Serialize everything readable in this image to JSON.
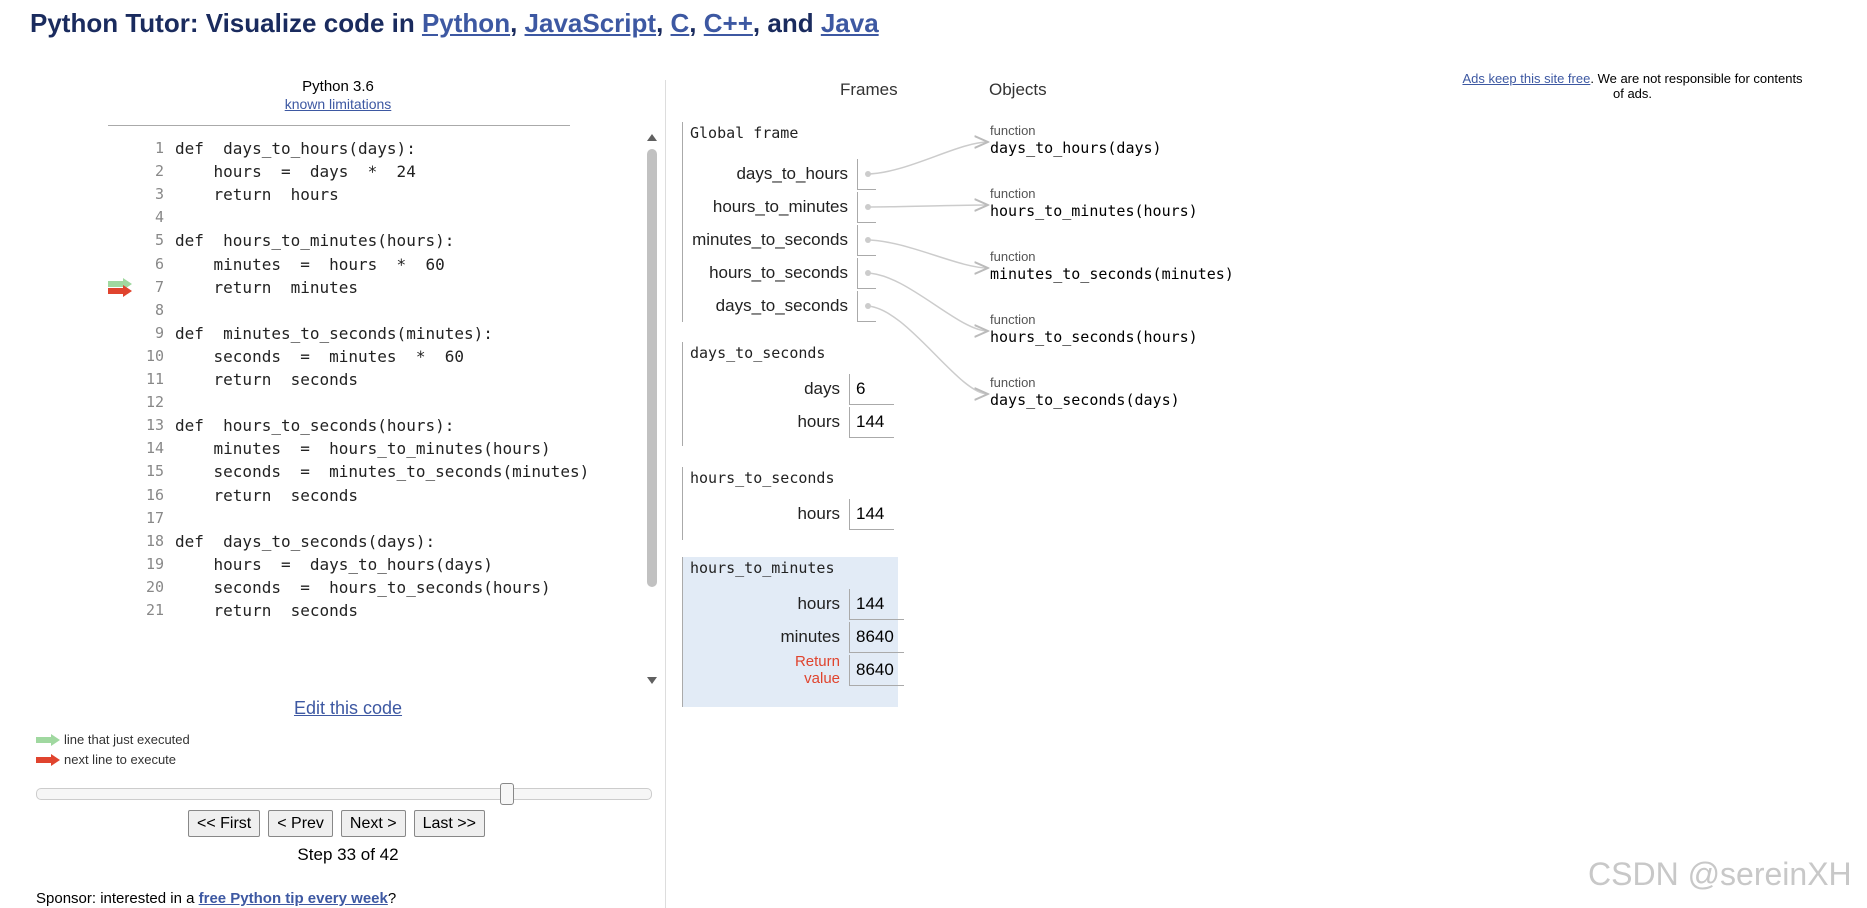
{
  "header": {
    "prefix": "Python Tutor: Visualize code in ",
    "langs": [
      "Python",
      "JavaScript",
      "C",
      "C++",
      "Java"
    ],
    "sep1": ", ",
    "sep2": ", ",
    "sep3": ", ",
    "sep4": ", and "
  },
  "editor": {
    "language": "Python 3.6",
    "limits_link": "known limitations",
    "edit_link": "Edit this code",
    "lines": [
      {
        "n": "1",
        "text": "def  days_to_hours(days):"
      },
      {
        "n": "2",
        "text": "    hours  =  days  *  24"
      },
      {
        "n": "3",
        "text": "    return  hours"
      },
      {
        "n": "4",
        "text": ""
      },
      {
        "n": "5",
        "text": "def  hours_to_minutes(hours):"
      },
      {
        "n": "6",
        "text": "    minutes  =  hours  *  60"
      },
      {
        "n": "7",
        "text": "    return  minutes"
      },
      {
        "n": "8",
        "text": ""
      },
      {
        "n": "9",
        "text": "def  minutes_to_seconds(minutes):"
      },
      {
        "n": "10",
        "text": "    seconds  =  minutes  *  60"
      },
      {
        "n": "11",
        "text": "    return  seconds"
      },
      {
        "n": "12",
        "text": ""
      },
      {
        "n": "13",
        "text": "def  hours_to_seconds(hours):"
      },
      {
        "n": "14",
        "text": "    minutes  =  hours_to_minutes(hours)"
      },
      {
        "n": "15",
        "text": "    seconds  =  minutes_to_seconds(minutes)"
      },
      {
        "n": "16",
        "text": "    return  seconds"
      },
      {
        "n": "17",
        "text": ""
      },
      {
        "n": "18",
        "text": "def  days_to_seconds(days):"
      },
      {
        "n": "19",
        "text": "    hours  =  days_to_hours(days)"
      },
      {
        "n": "20",
        "text": "    seconds  =  hours_to_seconds(hours)"
      },
      {
        "n": "21",
        "text": "    return  seconds"
      }
    ],
    "just_executed_line": "7",
    "next_line": "7"
  },
  "legend": {
    "just_executed": "line that just executed",
    "next_to_execute": "next line to execute",
    "green": "#a0d8a0",
    "red": "#e0442e"
  },
  "nav": {
    "first": "<< First",
    "prev": "< Prev",
    "next": "Next >",
    "last": "Last >>",
    "step_text": "Step 33 of 42",
    "progress": 0.764
  },
  "sponsor": {
    "prefix": "Sponsor: interested in a ",
    "link": "free Python tip every week",
    "suffix": "?"
  },
  "viz": {
    "frames_header": "Frames",
    "objects_header": "Objects",
    "frames": [
      {
        "name": "Global frame",
        "active": false,
        "vars": [
          {
            "name": "days_to_hours",
            "pointer": true
          },
          {
            "name": "hours_to_minutes",
            "pointer": true
          },
          {
            "name": "minutes_to_seconds",
            "pointer": true
          },
          {
            "name": "hours_to_seconds",
            "pointer": true
          },
          {
            "name": "days_to_seconds",
            "pointer": true
          }
        ]
      },
      {
        "name": "days_to_seconds",
        "active": false,
        "vars": [
          {
            "name": "days",
            "value": "6"
          },
          {
            "name": "hours",
            "value": "144"
          }
        ]
      },
      {
        "name": "hours_to_seconds",
        "active": false,
        "vars": [
          {
            "name": "hours",
            "value": "144"
          }
        ]
      },
      {
        "name": "hours_to_minutes",
        "active": true,
        "vars": [
          {
            "name": "hours",
            "value": "144"
          },
          {
            "name": "minutes",
            "value": "8640"
          },
          {
            "name": "Return\nvalue",
            "value": "8640",
            "ret": true
          }
        ]
      }
    ],
    "objects": [
      {
        "type": "function",
        "value": "days_to_hours(days)"
      },
      {
        "type": "function",
        "value": "hours_to_minutes(hours)"
      },
      {
        "type": "function",
        "value": "minutes_to_seconds(minutes)"
      },
      {
        "type": "function",
        "value": "hours_to_seconds(hours)"
      },
      {
        "type": "function",
        "value": "days_to_seconds(days)"
      }
    ],
    "active_frame_color": "#e2ebf6",
    "return_color": "#e0442e"
  },
  "ad": {
    "link": "Ads keep this site free",
    "text": ". We are not responsible for contents of ads."
  },
  "watermark": "CSDN @sereinXH"
}
